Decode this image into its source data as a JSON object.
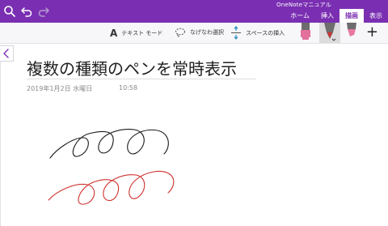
{
  "app": {
    "title": "OneNoteマニュアル"
  },
  "tabs": [
    {
      "label": "ホーム"
    },
    {
      "label": "挿入"
    },
    {
      "label": "描画",
      "active": true
    },
    {
      "label": "表示"
    }
  ],
  "toolbar": {
    "text_mode_label": "テキスト モード",
    "lasso_label": "なげなわ選択",
    "insert_space_label": "スペースの挿入",
    "add_label": "+"
  },
  "pens": [
    {
      "name": "pink-highlighter",
      "color": "#e1709c"
    },
    {
      "name": "red-pen",
      "color": "#d0312d",
      "selected": true
    },
    {
      "name": "pink-marker",
      "color": "#e6789f"
    }
  ],
  "page": {
    "title": "複数の種類のペンを常時表示",
    "date": "2019年1月2日 水曜日",
    "time": "10:58"
  },
  "ink": [
    {
      "name": "black-scribble",
      "color": "#1a1a1a"
    },
    {
      "name": "red-scribble",
      "color": "#d0312d"
    }
  ],
  "colors": {
    "ribbon": "#7a2fb2",
    "toolbar": "#f7f6f8"
  }
}
